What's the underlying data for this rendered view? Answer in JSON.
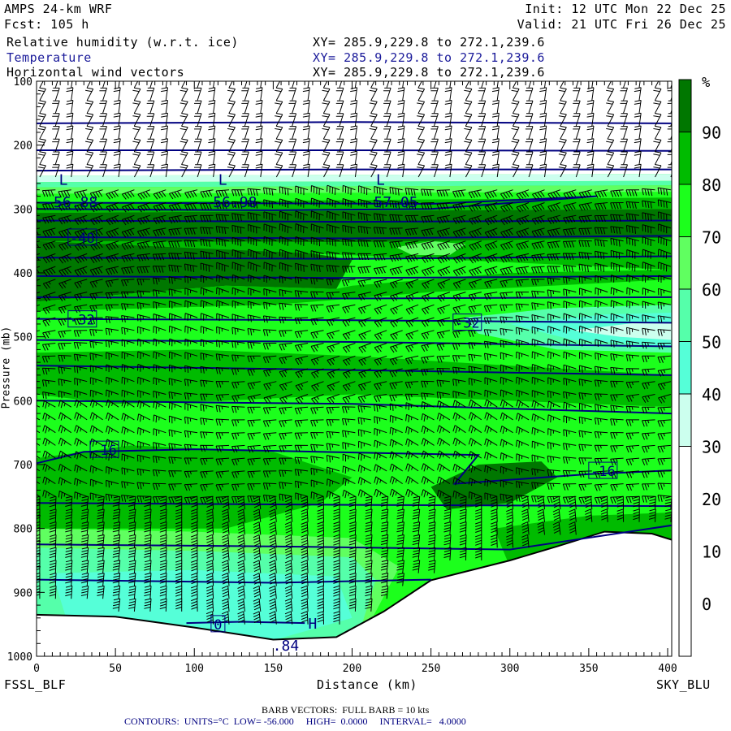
{
  "header": {
    "model": "AMPS 24-km WRF",
    "forecast": "Fcst: 105 h",
    "init": "Init: 12 UTC Mon 22 Dec 25",
    "valid": "Valid: 21 UTC Fri 26 Dec 25",
    "fields": [
      {
        "name": "Relative humidity (w.r.t. ice)",
        "xy": "XY= 285.9,229.8 to 272.1,239.6"
      },
      {
        "name": "Temperature",
        "xy": "XY= 285.9,229.8 to 272.1,239.6"
      },
      {
        "name": "Horizontal wind vectors",
        "xy": "XY= 285.9,229.8 to 272.1,239.6"
      }
    ]
  },
  "footer": {
    "left_endpoint": "FSSL_BLF",
    "right_endpoint": "SKY_BLU",
    "barb_note": "BARB VECTORS:  FULL BARB = 10 kts",
    "contours_note": "CONTOURS:  UNITS=°C  LOW= -56.000     HIGH=  0.0000     INTERVAL=   4.0000"
  },
  "colors": {
    "temp_contour": "#000080",
    "axis": "#000000"
  },
  "chart_data": {
    "type": "heatmap",
    "title": "Relative humidity (w.r.t. ice), Temperature, Horizontal wind vectors",
    "xlabel": "Distance (km)",
    "ylabel": "Pressure (mb)",
    "xlim": [
      0,
      403
    ],
    "ylim": [
      100,
      1000
    ],
    "x_ticks": [
      "0",
      "50",
      "100",
      "150",
      "200",
      "250",
      "300",
      "350",
      "400"
    ],
    "y_ticks": [
      "100",
      "200",
      "300",
      "400",
      "500",
      "600",
      "700",
      "800",
      "900",
      "1000"
    ],
    "colorbar": {
      "unit": "%",
      "labels": [
        "90",
        "80",
        "70",
        "60",
        "50",
        "40",
        "30",
        "20",
        "10",
        "0"
      ],
      "bins": [
        {
          "min": 90,
          "max": 100,
          "color": "#007700"
        },
        {
          "min": 80,
          "max": 90,
          "color": "#00bb00"
        },
        {
          "min": 70,
          "max": 80,
          "color": "#1cff1c"
        },
        {
          "min": 60,
          "max": 70,
          "color": "#60ff60"
        },
        {
          "min": 50,
          "max": 60,
          "color": "#55ffaa"
        },
        {
          "min": 40,
          "max": 50,
          "color": "#55ffd8"
        },
        {
          "min": 30,
          "max": 40,
          "color": "#ccffee"
        },
        {
          "min": -10,
          "max": 30,
          "color": "#ffffff"
        }
      ]
    },
    "rh_regions": [
      {
        "rh": 75,
        "pts": [
          [
            0,
            100
          ],
          [
            403,
            100
          ],
          [
            403,
            1000
          ],
          [
            0,
            1000
          ]
        ]
      },
      {
        "rh": 0,
        "pts": [
          [
            0,
            100
          ],
          [
            403,
            100
          ],
          [
            403,
            245
          ],
          [
            0,
            248
          ]
        ]
      },
      {
        "rh": 35,
        "pts": [
          [
            0,
            248
          ],
          [
            403,
            245
          ],
          [
            403,
            256
          ],
          [
            0,
            258
          ]
        ]
      },
      {
        "rh": 55,
        "pts": [
          [
            0,
            258
          ],
          [
            403,
            256
          ],
          [
            403,
            263
          ],
          [
            0,
            266
          ]
        ]
      },
      {
        "rh": 65,
        "pts": [
          [
            0,
            266
          ],
          [
            403,
            263
          ],
          [
            403,
            273
          ],
          [
            0,
            276
          ]
        ]
      },
      {
        "rh": 85,
        "pts": [
          [
            0,
            290
          ],
          [
            403,
            282
          ],
          [
            403,
            300
          ],
          [
            0,
            306
          ]
        ]
      },
      {
        "rh": 95,
        "pts": [
          [
            0,
            306
          ],
          [
            403,
            300
          ],
          [
            403,
            345
          ],
          [
            200,
            352
          ],
          [
            0,
            350
          ]
        ]
      },
      {
        "rh": 95,
        "pts": [
          [
            0,
            320
          ],
          [
            80,
            330
          ],
          [
            200,
            380
          ],
          [
            190,
            425
          ],
          [
            120,
            420
          ],
          [
            0,
            445
          ]
        ]
      },
      {
        "rh": 85,
        "pts": [
          [
            0,
            350
          ],
          [
            200,
            352
          ],
          [
            403,
            345
          ],
          [
            403,
            395
          ],
          [
            300,
            400
          ],
          [
            200,
            420
          ],
          [
            190,
            425
          ],
          [
            120,
            420
          ],
          [
            0,
            445
          ],
          [
            0,
            460
          ],
          [
            150,
            450
          ],
          [
            250,
            430
          ],
          [
            403,
            410
          ],
          [
            403,
            395
          ]
        ]
      },
      {
        "rh": 65,
        "pts": [
          [
            228,
            360
          ],
          [
            250,
            350
          ],
          [
            272,
            355
          ],
          [
            262,
            372
          ],
          [
            238,
            372
          ]
        ]
      },
      {
        "rh": 55,
        "pts": [
          [
            270,
            470
          ],
          [
            330,
            455
          ],
          [
            403,
            450
          ],
          [
            403,
            525
          ],
          [
            330,
            520
          ],
          [
            280,
            495
          ]
        ]
      },
      {
        "rh": 45,
        "pts": [
          [
            300,
            480
          ],
          [
            360,
            465
          ],
          [
            403,
            462
          ],
          [
            403,
            515
          ],
          [
            340,
            505
          ]
        ]
      },
      {
        "rh": 35,
        "pts": [
          [
            340,
            490
          ],
          [
            380,
            478
          ],
          [
            403,
            478
          ],
          [
            403,
            505
          ],
          [
            370,
            500
          ]
        ]
      },
      {
        "rh": 85,
        "pts": [
          [
            0,
            525
          ],
          [
            100,
            520
          ],
          [
            200,
            530
          ],
          [
            300,
            545
          ],
          [
            403,
            560
          ],
          [
            403,
            610
          ],
          [
            300,
            600
          ],
          [
            200,
            590
          ],
          [
            120,
            600
          ],
          [
            50,
            605
          ],
          [
            0,
            590
          ]
        ]
      },
      {
        "rh": 85,
        "pts": [
          [
            0,
            690
          ],
          [
            60,
            670
          ],
          [
            150,
            680
          ],
          [
            200,
            720
          ],
          [
            180,
            760
          ],
          [
            120,
            800
          ],
          [
            0,
            800
          ]
        ]
      },
      {
        "rh": 95,
        "pts": [
          [
            250,
            735
          ],
          [
            280,
            700
          ],
          [
            320,
            695
          ],
          [
            330,
            720
          ],
          [
            300,
            760
          ],
          [
            260,
            770
          ]
        ]
      },
      {
        "rh": 85,
        "pts": [
          [
            290,
            800
          ],
          [
            350,
            780
          ],
          [
            403,
            775
          ],
          [
            403,
            830
          ],
          [
            300,
            860
          ]
        ]
      },
      {
        "rh": 65,
        "pts": [
          [
            0,
            800
          ],
          [
            100,
            805
          ],
          [
            200,
            815
          ],
          [
            230,
            860
          ],
          [
            200,
            1000
          ],
          [
            0,
            1000
          ]
        ]
      },
      {
        "rh": 55,
        "pts": [
          [
            0,
            830
          ],
          [
            100,
            835
          ],
          [
            200,
            845
          ],
          [
            215,
            880
          ],
          [
            200,
            1000
          ],
          [
            0,
            1000
          ]
        ]
      },
      {
        "rh": 45,
        "pts": [
          [
            10,
            870
          ],
          [
            100,
            865
          ],
          [
            190,
            875
          ],
          [
            200,
            940
          ],
          [
            150,
            975
          ],
          [
            20,
            950
          ]
        ]
      }
    ],
    "terrain_profile": [
      [
        0,
        935
      ],
      [
        50,
        938
      ],
      [
        100,
        955
      ],
      [
        150,
        974
      ],
      [
        190,
        970
      ],
      [
        220,
        930
      ],
      [
        250,
        881
      ],
      [
        300,
        850
      ],
      [
        330,
        828
      ],
      [
        360,
        805
      ],
      [
        390,
        808
      ],
      [
        403,
        818
      ]
    ],
    "isotherms": [
      {
        "level": -56,
        "pts": [
          [
            0,
            166
          ],
          [
            200,
            164
          ],
          [
            403,
            166
          ]
        ]
      },
      {
        "level": -56,
        "pts": [
          [
            0,
            208
          ],
          [
            200,
            208
          ],
          [
            403,
            209
          ]
        ]
      },
      {
        "level": -56,
        "pts": [
          [
            0,
            240
          ],
          [
            200,
            238
          ],
          [
            403,
            238
          ]
        ]
      },
      {
        "level": -56,
        "pts": [
          [
            0,
            300
          ],
          [
            150,
            302
          ],
          [
            250,
            300
          ],
          [
            355,
            280
          ],
          [
            250,
            292
          ],
          [
            0,
            290
          ]
        ]
      },
      {
        "level": -52,
        "pts": [
          [
            0,
            318
          ],
          [
            200,
            320
          ],
          [
            403,
            318
          ]
        ]
      },
      {
        "level": -48,
        "pts": [
          [
            0,
            344
          ],
          [
            200,
            346
          ],
          [
            403,
            342
          ]
        ]
      },
      {
        "level": -44,
        "pts": [
          [
            0,
            376
          ],
          [
            200,
            378
          ],
          [
            403,
            374
          ]
        ]
      },
      {
        "level": -40,
        "pts": [
          [
            0,
            405
          ],
          [
            200,
            408
          ],
          [
            403,
            405
          ]
        ]
      },
      {
        "level": -36,
        "pts": [
          [
            0,
            438
          ],
          [
            200,
            440
          ],
          [
            403,
            438
          ]
        ]
      },
      {
        "level": -32,
        "pts": [
          [
            0,
            472
          ],
          [
            200,
            474
          ],
          [
            403,
            478
          ]
        ]
      },
      {
        "level": -28,
        "pts": [
          [
            0,
            505
          ],
          [
            200,
            508
          ],
          [
            403,
            515
          ]
        ]
      },
      {
        "level": -24,
        "pts": [
          [
            0,
            545
          ],
          [
            200,
            552
          ],
          [
            403,
            560
          ]
        ]
      },
      {
        "level": -20,
        "pts": [
          [
            0,
            600
          ],
          [
            200,
            605
          ],
          [
            403,
            620
          ]
        ]
      },
      {
        "level": -16,
        "pts": [
          [
            0,
            698
          ],
          [
            30,
            680
          ],
          [
            100,
            676
          ],
          [
            280,
            685
          ],
          [
            265,
            730
          ],
          [
            350,
            715
          ],
          [
            403,
            709
          ]
        ]
      },
      {
        "level": -12,
        "pts": [
          [
            0,
            760
          ],
          [
            200,
            763
          ],
          [
            403,
            765
          ]
        ]
      },
      {
        "level": -8,
        "pts": [
          [
            0,
            825
          ],
          [
            150,
            828
          ],
          [
            300,
            833
          ],
          [
            403,
            795
          ]
        ]
      },
      {
        "level": -4,
        "pts": [
          [
            0,
            880
          ],
          [
            150,
            885
          ],
          [
            250,
            880
          ]
        ]
      },
      {
        "level": 0,
        "pts": [
          [
            95,
            948
          ],
          [
            130,
            946
          ],
          [
            170,
            948
          ]
        ]
      }
    ],
    "contour_labels": [
      {
        "text": "-56.88",
        "km": 22,
        "mb": 288,
        "box": false
      },
      {
        "text": "-56.98",
        "km": 123,
        "mb": 288,
        "box": false
      },
      {
        "text": "-57.05",
        "km": 225,
        "mb": 288,
        "box": false
      },
      {
        "text": "L",
        "km": 17,
        "mb": 253,
        "box": false
      },
      {
        "text": "L",
        "km": 118,
        "mb": 253,
        "box": false
      },
      {
        "text": "L",
        "km": 218,
        "mb": 253,
        "box": false
      },
      {
        "text": "-48",
        "km": 29,
        "mb": 344,
        "box": true
      },
      {
        "text": "-32",
        "km": 29,
        "mb": 472,
        "box": true
      },
      {
        "text": "-32",
        "km": 273,
        "mb": 477,
        "box": true
      },
      {
        "text": "-16",
        "km": 43,
        "mb": 676,
        "box": true
      },
      {
        "text": "-16",
        "km": 359,
        "mb": 709,
        "box": true
      },
      {
        "text": "0",
        "km": 115,
        "mb": 949,
        "box": true
      },
      {
        "text": "H",
        "km": 175,
        "mb": 948,
        "box": false
      },
      {
        "text": ".84",
        "km": 158,
        "mb": 982,
        "box": false
      }
    ],
    "wind_barbs": {
      "full_barb_kts": 10,
      "km_step": 10,
      "mb_step": 20
    }
  }
}
